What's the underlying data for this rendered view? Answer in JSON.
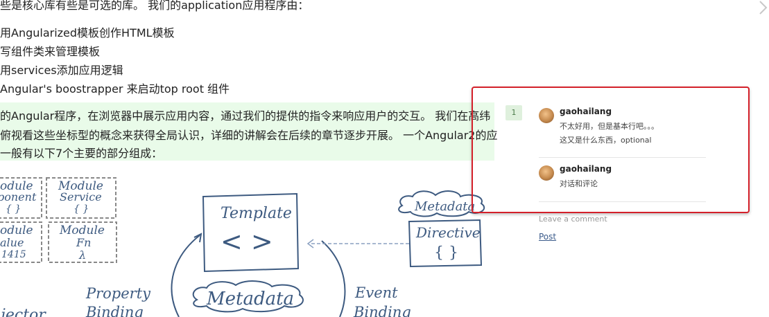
{
  "article": {
    "intro_line": "些是核心库有些是可选的库。 我们的application应用程序由：",
    "list_items": [
      "用Angularized模板创作HTML模板",
      "写组件类来管理模板",
      "用services添加应用逻辑",
      "Angular's boostrapper 来启动top root 组件"
    ],
    "highlight_lines": [
      "的Angular程序，在浏览器中展示应用内容，通过我们的提供的指令来响应用户的交互。 我们在高纬",
      "俯视看这些坐标型的概念来获得全局认识，详细的讲解会在后续的章节逐步开展。 一个Angular2的应",
      "一般有以下7个主要的部分组成："
    ]
  },
  "diagram": {
    "module_component_l1": "odule",
    "module_component_l2": "ponent",
    "module_component_l3": "{ }",
    "module_service_l1": "Module",
    "module_service_l2": "Service",
    "module_service_l3": "{ }",
    "module_value_l1": "odule",
    "module_value_l2": "alue",
    "module_value_l3": "1415",
    "module_fn_l1": "Module",
    "module_fn_l2": "Fn",
    "module_fn_l3": "λ",
    "template_label": "Template",
    "template_symbol": "< >",
    "metadata_top": "Metadata",
    "directive_label": "Directive",
    "directive_symbol": "{ }",
    "metadata_bottom": "Metadata",
    "property_l1": "Property",
    "property_l2": "Binding",
    "event_l1": "Event",
    "event_l2": "Binding",
    "injector_fragment": "ijector"
  },
  "comments": {
    "count": "1",
    "items": [
      {
        "author": "gaohailang",
        "lines": [
          "不太好用，但是基本行吧。。。",
          "这又是什么东西，optional"
        ]
      },
      {
        "author": "gaohailang",
        "lines": [
          "对话和评论"
        ]
      }
    ],
    "leave_comment": "Leave a comment",
    "post_label": "Post"
  },
  "colors": {
    "highlight_bg": "#e9fbe9",
    "panel_border": "#d4202a",
    "diagram_ink": "#3d5a80"
  },
  "icons": {
    "next_page": "chevron-right-icon"
  }
}
